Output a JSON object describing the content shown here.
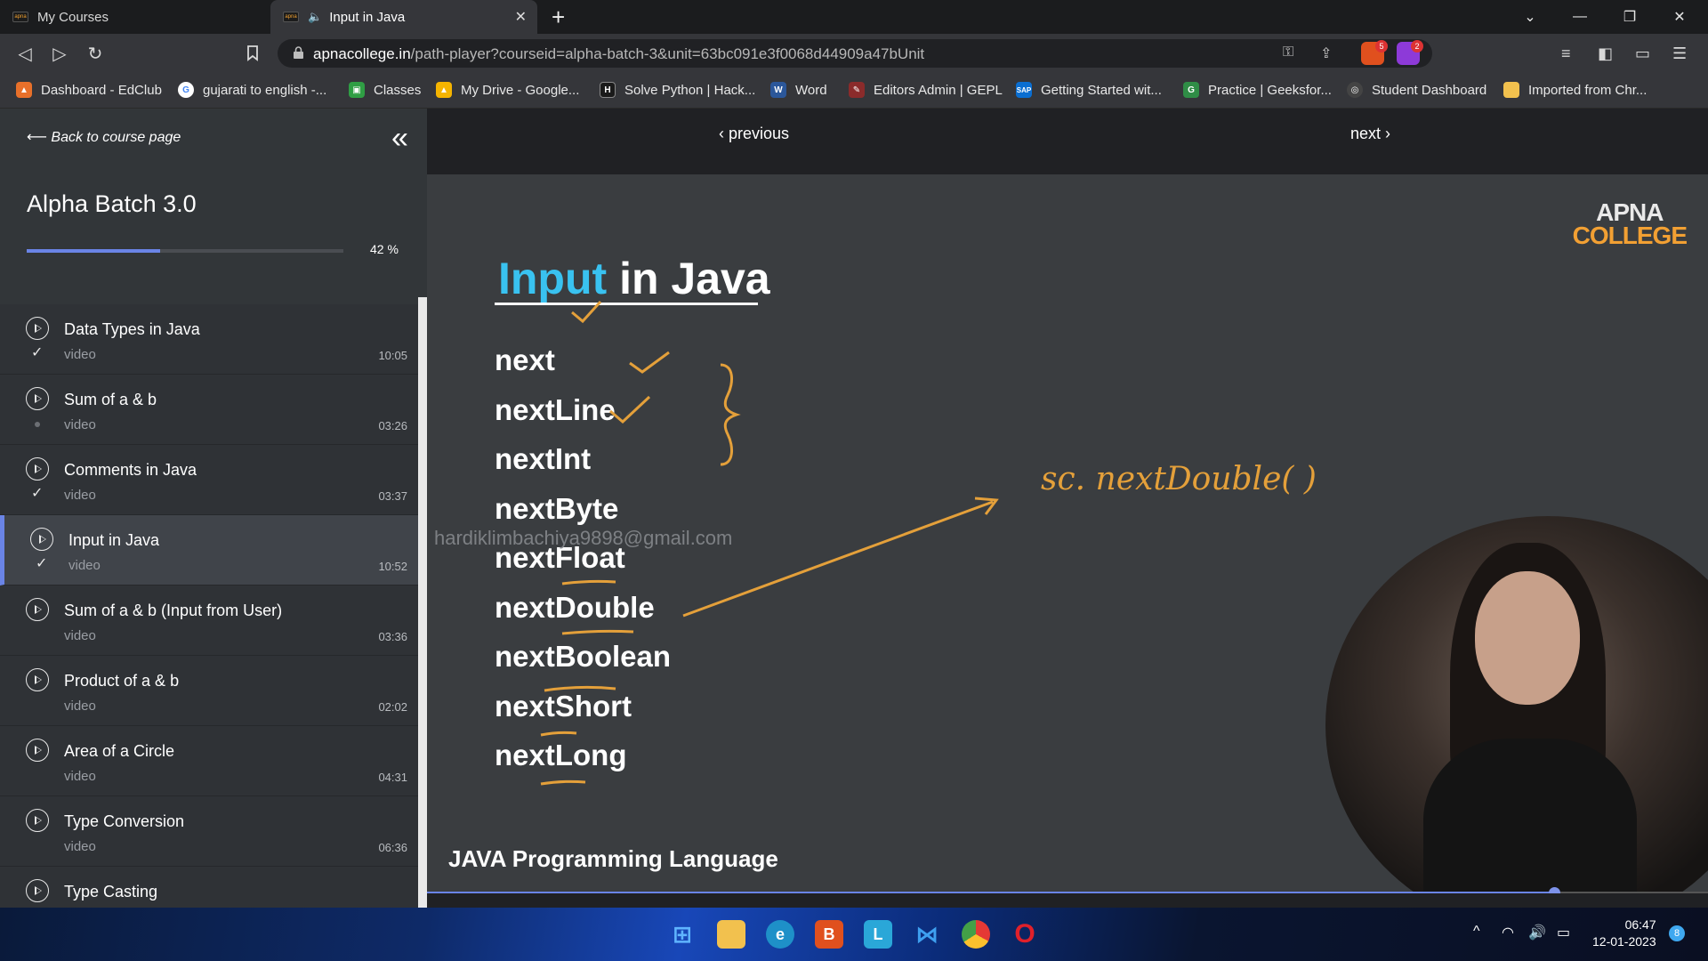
{
  "browser": {
    "tabs": [
      {
        "label": "My Courses",
        "active": false
      },
      {
        "label": "Input in Java",
        "active": true
      }
    ],
    "url_host": "apnacollege.in",
    "url_path": "/path-player?courseid=alpha-batch-3&unit=63bc091e3f0068d44909a47bUnit",
    "brave_shield_count": "5",
    "rewards_count": "2",
    "bookmarks": [
      {
        "label": "Dashboard - EdClub",
        "color": "#e8702a",
        "glyph": "🔥"
      },
      {
        "label": "gujarati to english -...",
        "color": "#ffffff",
        "glyph": "G"
      },
      {
        "label": "Classes",
        "color": "#2f9e44",
        "glyph": "▣"
      },
      {
        "label": "My Drive - Google...",
        "color": "#f5b400",
        "glyph": "▲"
      },
      {
        "label": "Solve Python | Hack...",
        "color": "#1a1a1a",
        "glyph": "H"
      },
      {
        "label": "Word",
        "color": "#2b579a",
        "glyph": "W"
      },
      {
        "label": "Editors Admin | GEPL",
        "color": "#8b2b2b",
        "glyph": "✎"
      },
      {
        "label": "Getting Started wit...",
        "color": "#0a6ed1",
        "glyph": "S"
      },
      {
        "label": "Practice | Geeksfor...",
        "color": "#2f8d46",
        "glyph": "G"
      },
      {
        "label": "Student Dashboard",
        "color": "#444444",
        "glyph": "◎"
      },
      {
        "label": "Imported from Chr...",
        "color": "#f2c14e",
        "glyph": "▬"
      }
    ]
  },
  "sidebar": {
    "back_label": "Back to course page",
    "course_title": "Alpha Batch 3.0",
    "progress_percent": 42,
    "progress_label": "42 %",
    "items": [
      {
        "title": "Data Types in Java",
        "type": "video",
        "duration": "10:05",
        "status": "done",
        "active": false
      },
      {
        "title": "Sum of a & b",
        "type": "video",
        "duration": "03:26",
        "status": "pending",
        "active": false
      },
      {
        "title": "Comments in Java",
        "type": "video",
        "duration": "03:37",
        "status": "done",
        "active": false
      },
      {
        "title": "Input in Java",
        "type": "video",
        "duration": "10:52",
        "status": "done",
        "active": true
      },
      {
        "title": "Sum of a & b (Input from User)",
        "type": "video",
        "duration": "03:36",
        "status": "none",
        "active": false
      },
      {
        "title": "Product of a & b",
        "type": "video",
        "duration": "02:02",
        "status": "none",
        "active": false
      },
      {
        "title": "Area of a Circle",
        "type": "video",
        "duration": "04:31",
        "status": "none",
        "active": false
      },
      {
        "title": "Type Conversion",
        "type": "video",
        "duration": "06:36",
        "status": "none",
        "active": false
      },
      {
        "title": "Type Casting",
        "type": "video",
        "duration": "",
        "status": "none",
        "active": false
      }
    ]
  },
  "player_nav": {
    "previous_label": "previous",
    "next_label": "next"
  },
  "slide": {
    "brand_top": "APNA",
    "brand_bottom": "COLLEGE",
    "title_accent": "Input",
    "title_rest": " in Java",
    "methods": [
      "next",
      "nextLine",
      "nextInt",
      "nextByte",
      "nextFloat",
      "nextDouble",
      "nextBoolean",
      "nextShort",
      "nextLong"
    ],
    "watermark": "hardiklimbachiya9898@gmail.com",
    "handwritten_note": "sc. nextDouble( )",
    "footer": "JAVA Programming Language",
    "accent_color": "#39c2f0",
    "ink_color": "#e4a03a",
    "playback_fraction": 0.88
  },
  "taskbar": {
    "time": "06:47",
    "date": "12-01-2023",
    "notifications": "8"
  }
}
